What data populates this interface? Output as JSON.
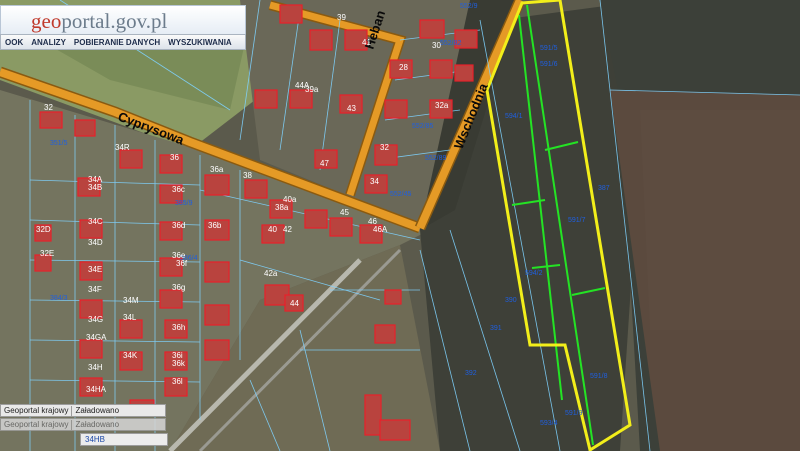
{
  "header": {
    "logo_prefix": "geo",
    "logo_rest": "portal",
    "logo_suffix": ".gov.pl"
  },
  "toolbar": {
    "items": [
      "OOK",
      "ANALIZY",
      "POBIERANIE DANYCH",
      "WYSZUKIWANIA"
    ]
  },
  "status": {
    "source": "Geoportal krajowy",
    "state": "Załadowano",
    "source_ghost": "Geoportal krajowy",
    "state_ghost": "Załadowano",
    "tag": "34HB"
  },
  "streets": {
    "s1": "Cyprysowa",
    "s2": "Wschodnia",
    "s3": "Heban"
  },
  "parcels": [
    "591/5",
    "591/6",
    "594/1",
    "594/2",
    "591/7",
    "591/8",
    "387",
    "390",
    "391",
    "392",
    "593/4",
    "591/9",
    "552/9",
    "552/82",
    "552/85",
    "552/89",
    "552/45",
    "351/5",
    "384/3",
    "385/9",
    "386/4"
  ],
  "house_numbers": [
    "32",
    "34R",
    "34A",
    "34B",
    "34C",
    "34D",
    "34E",
    "34F",
    "34G",
    "34GA",
    "34H",
    "34HA",
    "34K",
    "34L",
    "34M",
    "32D",
    "32E",
    "36",
    "36c",
    "36d",
    "36e",
    "36f",
    "36g",
    "36h",
    "36i",
    "36k",
    "36l",
    "36a",
    "36b",
    "38",
    "38a",
    "40",
    "40a",
    "42",
    "42a",
    "44",
    "45",
    "46",
    "46A",
    "47",
    "39",
    "39a",
    "41",
    "43",
    "44A",
    "28",
    "30",
    "32",
    "34",
    "32a"
  ],
  "colors": {
    "road": "#e59a26",
    "road_edge": "#8a5a10",
    "selection": "#f2ee1a",
    "subparcel": "#24e324",
    "parcel_line": "#7fd3ff",
    "house_hl": "#e8202a"
  }
}
